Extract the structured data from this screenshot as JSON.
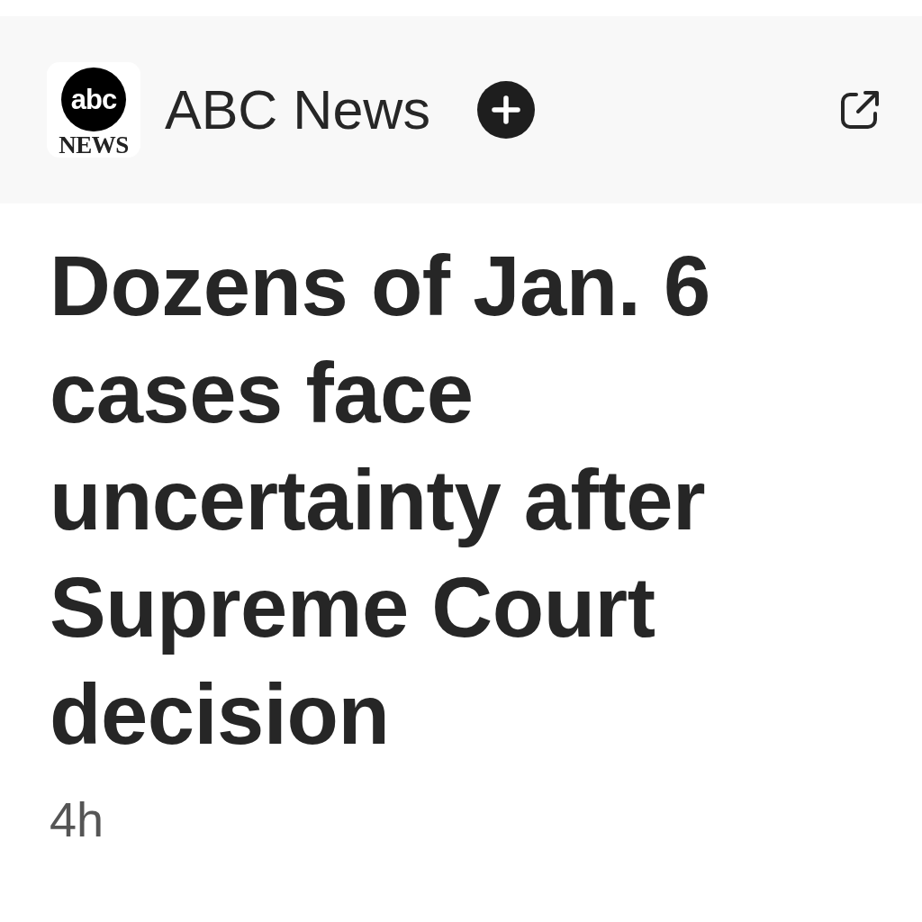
{
  "header": {
    "logo": {
      "mark": "abc",
      "wordmark": "NEWS"
    },
    "source_name": "ABC News"
  },
  "article": {
    "headline": "Dozens of Jan. 6 cases face uncertainty after Supreme Court decision",
    "age": "4h"
  }
}
